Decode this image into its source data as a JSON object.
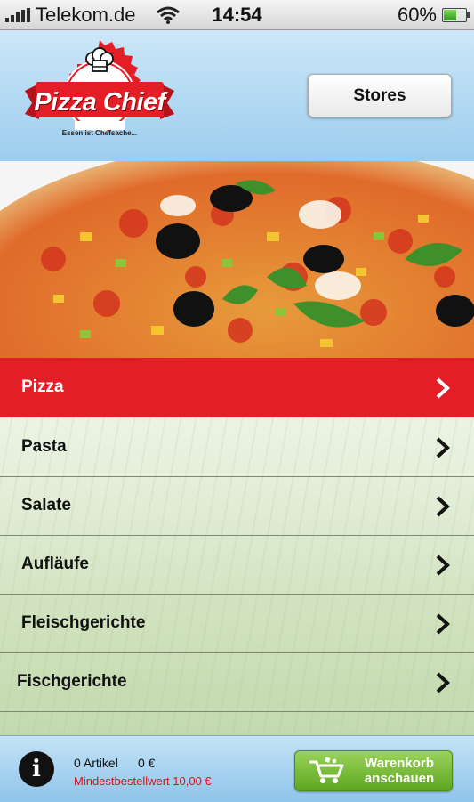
{
  "status_bar": {
    "carrier": "Telekom.de",
    "time": "14:54",
    "battery_percent": "60%",
    "battery_level": 0.6
  },
  "header": {
    "logo_title": "Pizza Chief",
    "logo_tagline": "Essen ist Chefsache...",
    "stores_label": "Stores"
  },
  "menu": {
    "items": [
      {
        "label": "Pizza",
        "active": true
      },
      {
        "label": "Pasta",
        "active": false
      },
      {
        "label": "Salate",
        "active": false
      },
      {
        "label": "Aufläufe",
        "active": false
      },
      {
        "label": "Fleischgerichte",
        "active": false
      },
      {
        "label": "Fischgerichte",
        "active": false
      }
    ]
  },
  "cart": {
    "article_count": "0 Artikel",
    "total": "0 €",
    "minimum_order": "Mindestbestellwert 10,00 €",
    "button_label_line1": "Warenkorb",
    "button_label_line2": "anschauen"
  },
  "colors": {
    "accent_red": "#e41e26",
    "cart_green": "#6cb52c",
    "header_blue": "#a9d4f0"
  },
  "icons": [
    "signal-icon",
    "wifi-icon",
    "battery-icon",
    "chef-hat-icon",
    "chevron-right-icon",
    "info-icon",
    "cart-icon"
  ]
}
